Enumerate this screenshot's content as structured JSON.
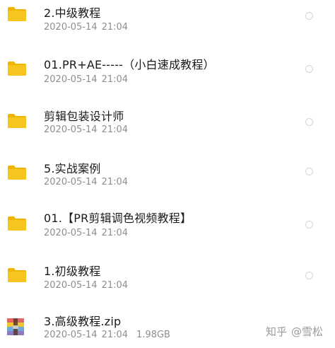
{
  "files": [
    {
      "name": "2.中级教程",
      "date": "2020-05-14",
      "time": "21:04",
      "size": "",
      "type": "folder-icon"
    },
    {
      "name": "01.PR+AE-----（小白速成教程）",
      "date": "2020-05-14",
      "time": "21:04",
      "size": "",
      "type": "folder-icon"
    },
    {
      "name": "剪辑包装设计师",
      "date": "2020-05-14",
      "time": "21:04",
      "size": "",
      "type": "folder-icon"
    },
    {
      "name": "5.实战案例",
      "date": "2020-05-14",
      "time": "21:04",
      "size": "",
      "type": "folder-icon"
    },
    {
      "name": "01.【PR剪辑调色视频教程】",
      "date": "2020-05-14",
      "time": "21:04",
      "size": "",
      "type": "folder-icon"
    },
    {
      "name": "1.初级教程",
      "date": "2020-05-14",
      "time": "21:04",
      "size": "",
      "type": "folder-icon"
    },
    {
      "name": "3.高级教程.zip",
      "date": "2020-05-14",
      "time": "21:04",
      "size": "1.98GB",
      "type": "zip-archive-icon"
    }
  ],
  "watermark": {
    "site": "知乎",
    "user": "@雪松"
  },
  "colors": {
    "folder": "#f7c520",
    "folder_tab": "#f0b400",
    "name_text": "#1a1a1a",
    "meta_text": "#8e8e8e"
  }
}
